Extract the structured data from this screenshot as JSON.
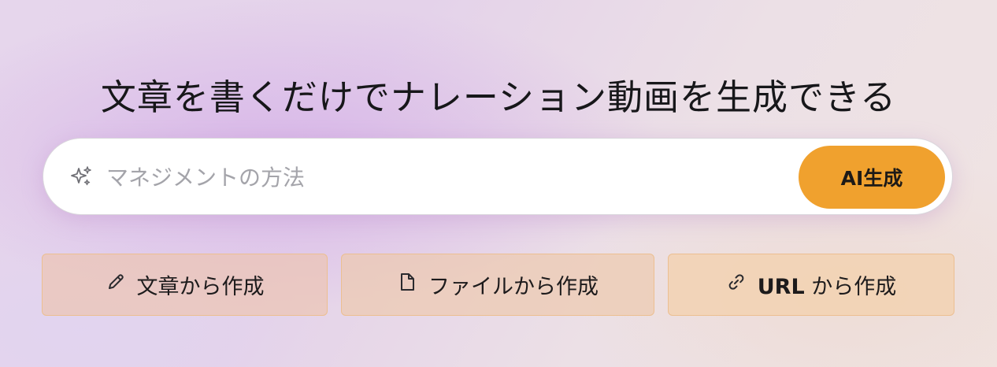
{
  "headline": "文章を書くだけでナレーション動画を生成できる",
  "search": {
    "icon": "sparkle-icon",
    "placeholder": "マネジメントの方法",
    "value": "",
    "button_label": "AI生成"
  },
  "options": [
    {
      "icon": "pencil-icon",
      "label": "文章から作成"
    },
    {
      "icon": "file-icon",
      "label": "ファイルから作成"
    },
    {
      "icon": "link-icon",
      "label_prefix": "URL",
      "label": " から作成"
    }
  ],
  "colors": {
    "accent": "#f0a12e",
    "option_border": "#ecbf91",
    "placeholder": "#a4a4aa"
  }
}
